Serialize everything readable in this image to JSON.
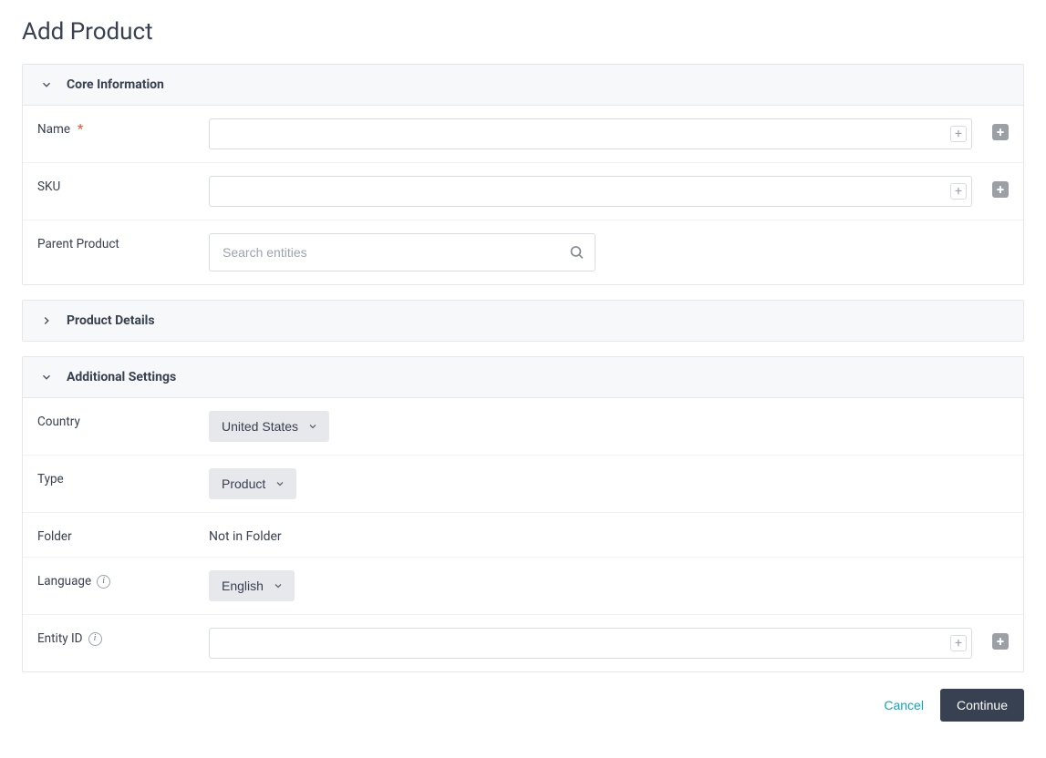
{
  "page": {
    "title": "Add Product"
  },
  "sections": {
    "core": {
      "title": "Core Information",
      "fields": {
        "name": {
          "label": "Name",
          "value": ""
        },
        "sku": {
          "label": "SKU",
          "value": ""
        },
        "parent": {
          "label": "Parent Product",
          "placeholder": "Search entities"
        }
      }
    },
    "details": {
      "title": "Product Details"
    },
    "additional": {
      "title": "Additional Settings",
      "fields": {
        "country": {
          "label": "Country",
          "value": "United States"
        },
        "type": {
          "label": "Type",
          "value": "Product"
        },
        "folder": {
          "label": "Folder",
          "value": "Not in Folder"
        },
        "language": {
          "label": "Language",
          "value": "English"
        },
        "entity_id": {
          "label": "Entity ID",
          "value": ""
        }
      }
    }
  },
  "footer": {
    "cancel": "Cancel",
    "continue": "Continue"
  }
}
